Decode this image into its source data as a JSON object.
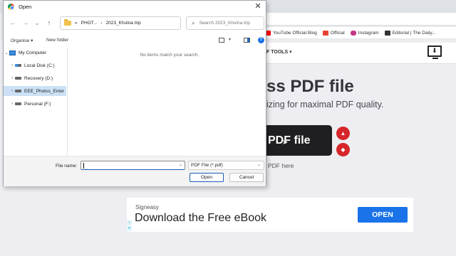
{
  "browser": {
    "bookmarks": [
      {
        "label": "YouTube Official Blog",
        "icon": "youtube-icon",
        "color": "#ff0000"
      },
      {
        "label": "Official",
        "icon": "gmail-icon",
        "color": "#ea4335"
      },
      {
        "label": "Instagram",
        "icon": "instagram-icon",
        "color": "#c13584"
      },
      {
        "label": "Editorial | The Daily...",
        "icon": "editorial-icon",
        "color": "#333333"
      }
    ]
  },
  "website": {
    "nav_pdf_tools": "F TOOLS ▾",
    "hero_title": "ss PDF file",
    "hero_subtitle": "izing for maximal PDF quality.",
    "select_button": "PDF file",
    "drop_text": "PDF here",
    "accent_color": "#d6262b"
  },
  "ad": {
    "brand": "Signeasy",
    "headline": "Download the Free eBook",
    "cta": "OPEN",
    "cta_color": "#1a73e8"
  },
  "dialog": {
    "title": "Open",
    "close_glyph": "✕",
    "nav": {
      "back": "←",
      "forward": "→",
      "recent": "⌄",
      "up": "↑"
    },
    "address": {
      "root_chev": "«",
      "segments": [
        "PHOT...",
        "2023_Khulna trip"
      ],
      "separator": "›",
      "dropdown": "⌄",
      "refresh": "↻"
    },
    "search_placeholder": "Search 2023_Khulna trip",
    "commands": {
      "organise": "Organise ▾",
      "new_folder": "New folder",
      "help": "?"
    },
    "tree": [
      {
        "label": "My Computer",
        "expanded": true,
        "icon": "computer-icon"
      },
      {
        "label": "Local Disk (C:)",
        "icon": "windows-drive-icon"
      },
      {
        "label": "Recovery (D:)",
        "icon": "drive-icon"
      },
      {
        "label": "EEE_Photos_Enter",
        "icon": "drive-icon",
        "selected": true
      },
      {
        "label": "Personal (F:)",
        "icon": "drive-icon"
      }
    ],
    "empty_message": "No items match your search.",
    "file_name_label": "File name:",
    "file_name_value": "",
    "file_type": "PDF File (*.pdf)",
    "open_button": "Open",
    "cancel_button": "Cancel"
  }
}
